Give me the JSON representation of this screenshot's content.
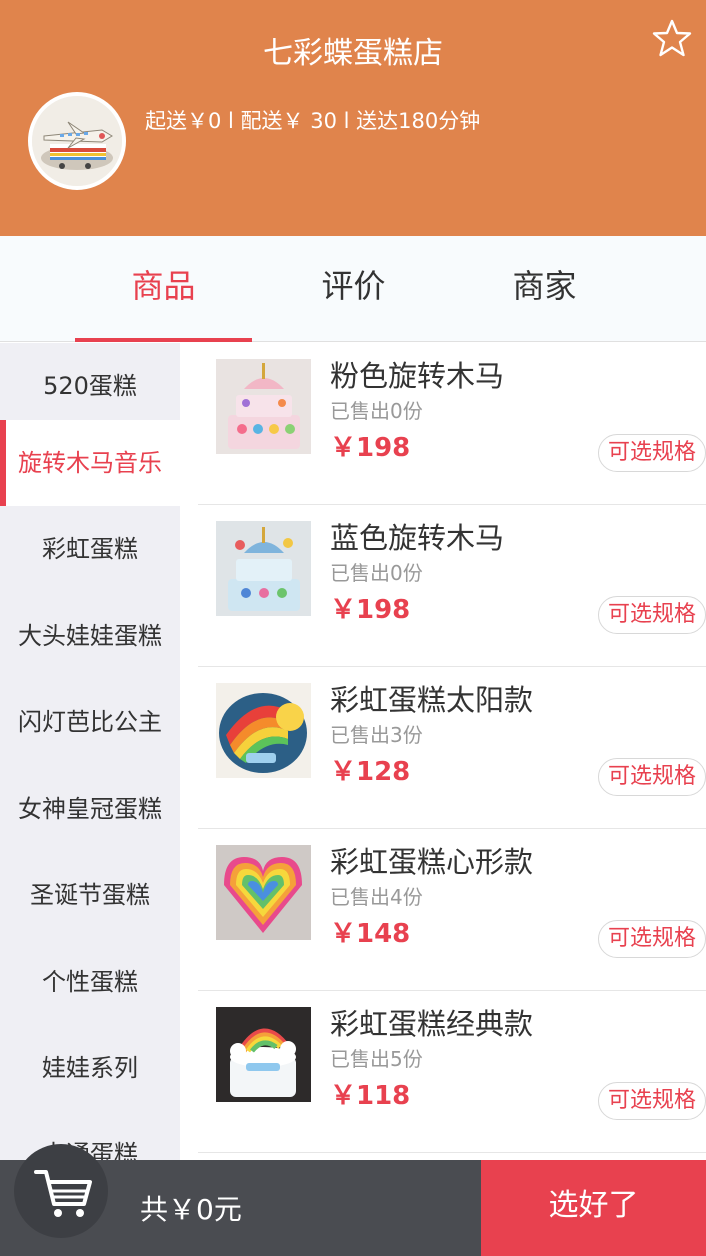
{
  "header": {
    "title": "七彩蝶蛋糕店",
    "favorite_icon": "star-outline-icon",
    "info": "起送￥0 l 配送￥ 30 l 送达180分钟"
  },
  "tabs": [
    {
      "label": "商品",
      "active": true
    },
    {
      "label": "评价",
      "active": false
    },
    {
      "label": "商家",
      "active": false
    }
  ],
  "categories": [
    {
      "label": "520蛋糕",
      "active": false
    },
    {
      "label": "旋转木马音乐",
      "active": true
    },
    {
      "label": "彩虹蛋糕",
      "active": false
    },
    {
      "label": "大头娃娃蛋糕",
      "active": false
    },
    {
      "label": "闪灯芭比公主",
      "active": false
    },
    {
      "label": "女神皇冠蛋糕",
      "active": false
    },
    {
      "label": "圣诞节蛋糕",
      "active": false
    },
    {
      "label": "个性蛋糕",
      "active": false
    },
    {
      "label": "娃娃系列",
      "active": false
    },
    {
      "label": "卡通蛋糕",
      "active": false
    }
  ],
  "products": [
    {
      "name": "粉色旋转木马",
      "sold": "已售出0份",
      "price": "￥198",
      "spec_label": "可选规格"
    },
    {
      "name": "蓝色旋转木马",
      "sold": "已售出0份",
      "price": "￥198",
      "spec_label": "可选规格"
    },
    {
      "name": "彩虹蛋糕太阳款",
      "sold": "已售出3份",
      "price": "￥128",
      "spec_label": "可选规格"
    },
    {
      "name": "彩虹蛋糕心形款",
      "sold": "已售出4份",
      "price": "￥148",
      "spec_label": "可选规格"
    },
    {
      "name": "彩虹蛋糕经典款",
      "sold": "已售出5份",
      "price": "￥118",
      "spec_label": "可选规格"
    }
  ],
  "cart": {
    "icon": "shopping-cart-icon",
    "total": "共￥0元",
    "confirm_label": "选好了"
  },
  "colors": {
    "header_bg": "#e0844c",
    "accent": "#e8414f",
    "cart_bar_bg": "#4a4c51"
  }
}
